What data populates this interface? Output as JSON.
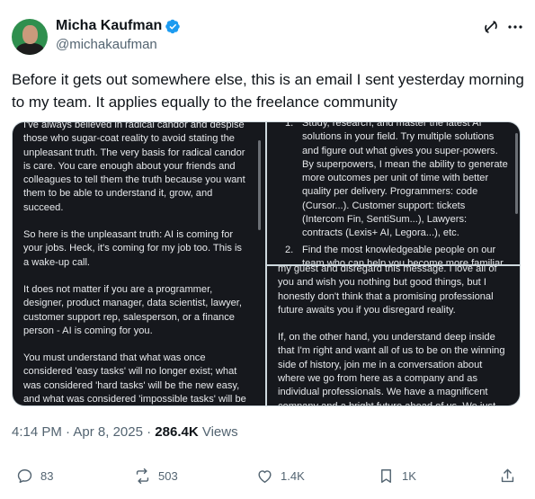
{
  "author": {
    "display_name": "Micha Kaufman",
    "handle": "@michakaufman"
  },
  "tweet": {
    "text": "Before it gets out somewhere else, this is an email I sent yesterday morning to my team. It applies equally to the freelance community"
  },
  "email_left": {
    "paragraphs": [
      "I've always believed in radical candor and despise those who sugar-coat reality to avoid stating the unpleasant truth. The very basis for radical candor is care. You care enough about your friends and colleagues to tell them the truth because you want them to be able to understand it, grow, and succeed.",
      "So here is the unpleasant truth: AI is coming for your jobs. Heck, it's coming for my job too. This is a wake-up call.",
      "It does not matter if you are a programmer, designer, product manager, data scientist, lawyer, customer support rep, salesperson, or a finance person - AI is coming for you.",
      "You must understand that what was once considered 'easy tasks' will no longer exist; what was considered 'hard tasks' will be the new easy, and what was considered 'impossible tasks' will be the new hard. If you do not become an exceptional talent at what you"
    ]
  },
  "email_top_right": {
    "items": [
      {
        "num": "1.",
        "text": "Study, research, and master the latest AI solutions in your field. Try multiple solutions and figure out what gives you super-powers. By superpowers, I mean the ability to generate more outcomes per unit of time with better quality per delivery. Programmers: code (Cursor...). Customer support: tickets (Intercom Fin, SentiSum...), Lawyers: contracts (Lexis+ AI, Legora...), etc."
      },
      {
        "num": "2.",
        "text": "Find the most knowledgeable people on our team who can help you become more familiar with the latest and greatest in AI"
      }
    ]
  },
  "email_bottom_right": {
    "paragraphs": [
      "my guest and disregard this message. I love all of you and wish you nothing but good things, but I honestly don't think that a promising professional future awaits you if you disregard reality.",
      "If, on the other hand, you understand deep inside that I'm right and want all of us to be on the winning side of history, join me in a conversation about where we go from here as a company and as individual professionals. We have a magnificent company and a bright future ahead of us. We just need to wake up"
    ]
  },
  "meta": {
    "time": "4:14 PM",
    "separator": "·",
    "date": "Apr 8, 2025",
    "views_count": "286.4K",
    "views_label": "Views"
  },
  "actions": {
    "replies": "83",
    "reposts": "503",
    "likes": "1.4K",
    "bookmarks": "1K"
  },
  "colors": {
    "verified": "#1d9bf0",
    "secondary_text": "#536471",
    "email_bg": "#16181d"
  },
  "icons": [
    "verified-badge-icon",
    "grok-icon",
    "more-icon",
    "reply-icon",
    "repost-icon",
    "like-icon",
    "bookmark-icon",
    "share-icon"
  ]
}
